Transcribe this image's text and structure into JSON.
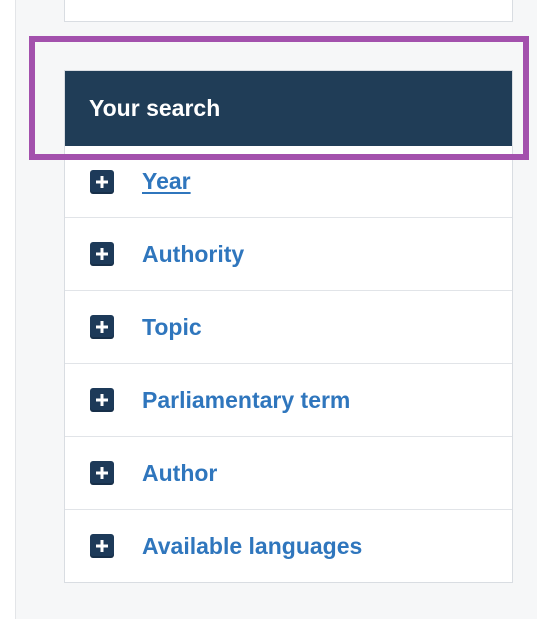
{
  "panel": {
    "title": "Your search",
    "items": [
      {
        "label": "Year"
      },
      {
        "label": "Authority"
      },
      {
        "label": "Topic"
      },
      {
        "label": "Parliamentary term"
      },
      {
        "label": "Author"
      },
      {
        "label": "Available languages"
      }
    ]
  },
  "colors": {
    "header_background": "#203d57",
    "link_blue": "#2f76bd",
    "plus_box": "#1d3a59",
    "highlight_frame": "#a351ad"
  },
  "icons": {
    "expand": "plus-icon"
  }
}
